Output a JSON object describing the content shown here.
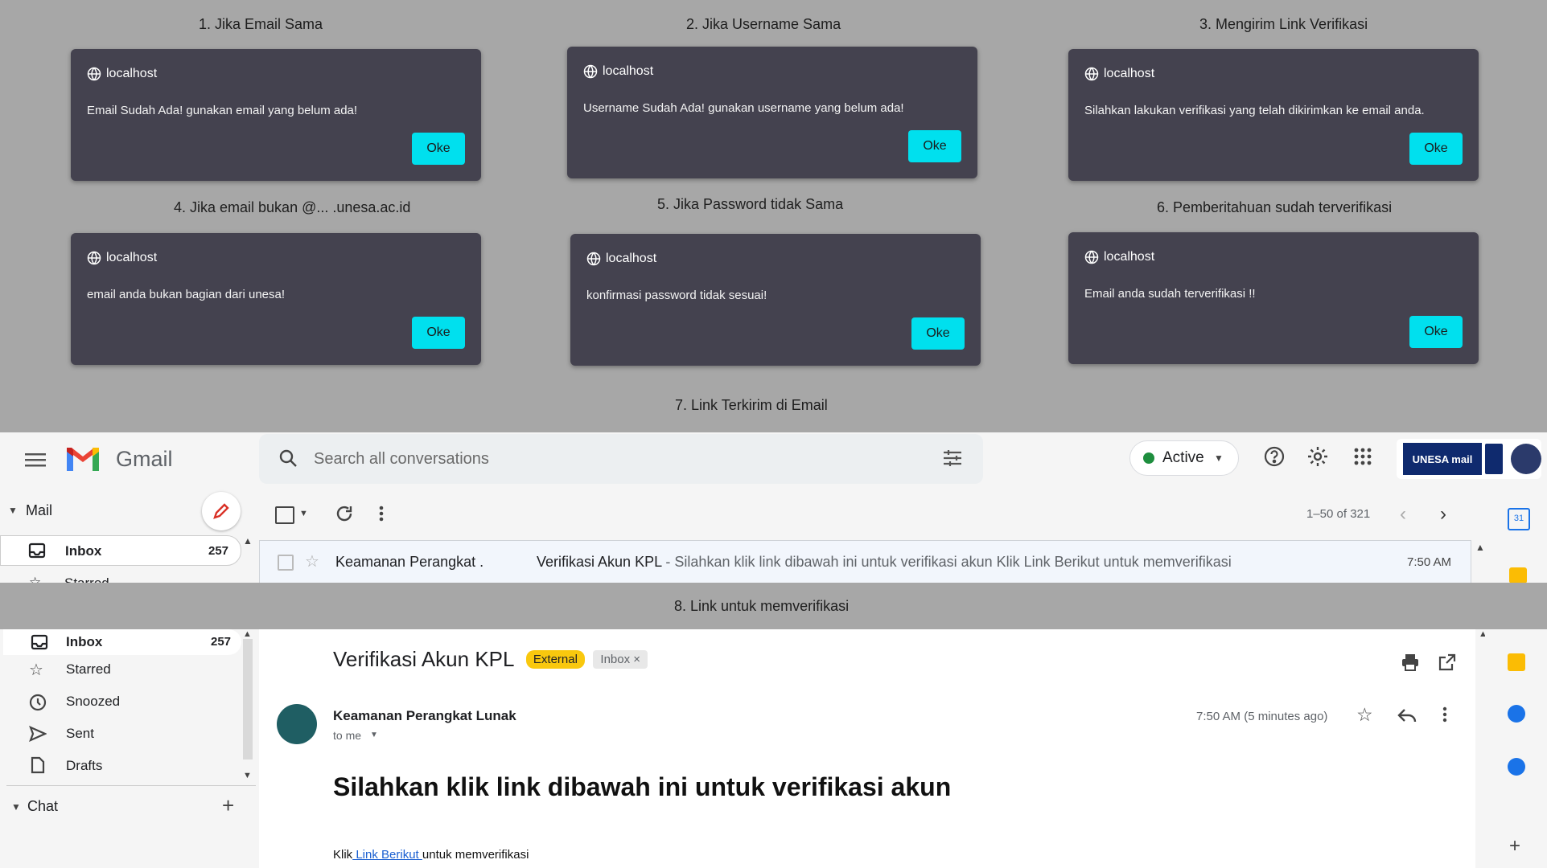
{
  "captions": {
    "c1": "1. Jika Email Sama",
    "c2": "2. Jika Username Sama",
    "c3": "3. Mengirim Link Verifikasi",
    "c4": "4. Jika email bukan @... .unesa.ac.id",
    "c5": "5. Jika Password tidak Sama",
    "c6": "6. Pemberitahuan sudah terverifikasi",
    "c7": "7. Link Terkirim di Email",
    "c8": "8. Link untuk memverifikasi"
  },
  "dialogs": [
    {
      "host": "localhost",
      "message": "Email Sudah Ada! gunakan email yang belum ada!",
      "button": "Oke"
    },
    {
      "host": "localhost",
      "message": "Username Sudah Ada! gunakan username yang belum ada!",
      "button": "Oke"
    },
    {
      "host": "localhost",
      "message": "Silahkan lakukan verifikasi yang telah dikirimkan ke email anda.",
      "button": "Oke"
    },
    {
      "host": "localhost",
      "message": "email anda bukan bagian dari unesa!",
      "button": "Oke"
    },
    {
      "host": "localhost",
      "message": "konfirmasi password tidak sesuai!",
      "button": "Oke"
    },
    {
      "host": "localhost",
      "message": "Email anda sudah terverifikasi !!",
      "button": "Oke"
    }
  ],
  "gmail": {
    "brand": "Gmail",
    "search_placeholder": "Search all conversations",
    "status": "Active",
    "unesa_logo": "UNESA mail",
    "mail_label": "Mail",
    "inbox_label": "Inbox",
    "inbox_count": "257",
    "starred_partial": "Starred",
    "pagination": "1–50 of 321",
    "row": {
      "sender": "Keamanan Perangkat .",
      "subject": "Verifikasi Akun KPL",
      "snippet": " - Silahkan klik link dibawah ini untuk verifikasi akun Klik Link Berikut untuk memverifikasi",
      "time": "7:50 AM"
    }
  },
  "gmail_detail": {
    "nav": {
      "inbox": "Inbox",
      "inbox_count": "257",
      "starred": "Starred",
      "snoozed": "Snoozed",
      "sent": "Sent",
      "drafts": "Drafts",
      "chat": "Chat"
    },
    "subject": "Verifikasi Akun KPL",
    "badge_external": "External",
    "badge_inbox": "Inbox",
    "sender": "Keamanan Perangkat Lunak",
    "to": "to me",
    "time": "7:50 AM (5 minutes ago)",
    "heading": "Silahkan klik link dibawah ini untuk verifikasi akun",
    "body_prefix": "Klik",
    "body_link": " Link Berikut ",
    "body_suffix": "untuk memverifikasi",
    "rail_calendar_day": "31"
  },
  "colors": {
    "dialog_bg": "#44424f",
    "ok_button": "#00e0ee",
    "external_badge": "#f9c80e",
    "link": "#1a5fd1"
  }
}
